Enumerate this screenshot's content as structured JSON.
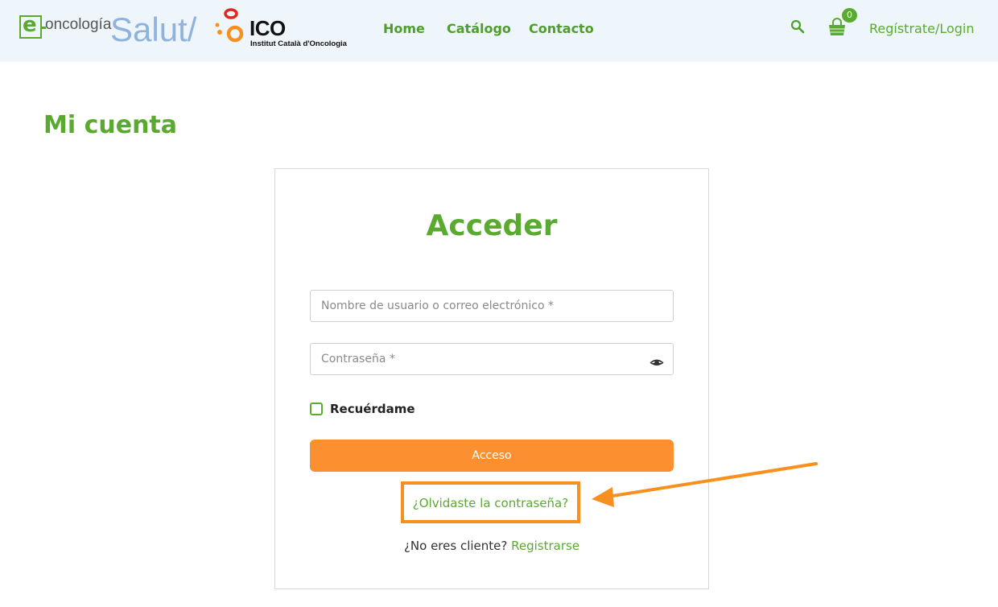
{
  "header": {
    "logo_onco": "oncología",
    "logo_salut": "Salut/",
    "logo_ico": "ICO",
    "logo_ico_sub": "Institut Català d'Oncologia",
    "nav": [
      "Home",
      "Catálogo",
      "Contacto"
    ],
    "cart_count": "0",
    "login_label": "Regístrate/Login"
  },
  "page": {
    "title": "Mi cuenta"
  },
  "login": {
    "heading": "Acceder",
    "username_placeholder": "Nombre de usuario o correo electrónico *",
    "password_placeholder": "Contraseña *",
    "remember_label": "Recuérdame",
    "submit_label": "Acceso",
    "forgot_label": "¿Olvidaste la contraseña?",
    "no_client_text": "¿No eres cliente?",
    "register_label": "Registrarse"
  },
  "colors": {
    "brand_green": "#5aaa2f",
    "accent_orange": "#fc9030",
    "header_bg": "#eef6fc",
    "annotation_orange": "#f7901e"
  },
  "icons": [
    "search-icon",
    "cart-icon",
    "eye-icon",
    "arrow-annotation"
  ]
}
